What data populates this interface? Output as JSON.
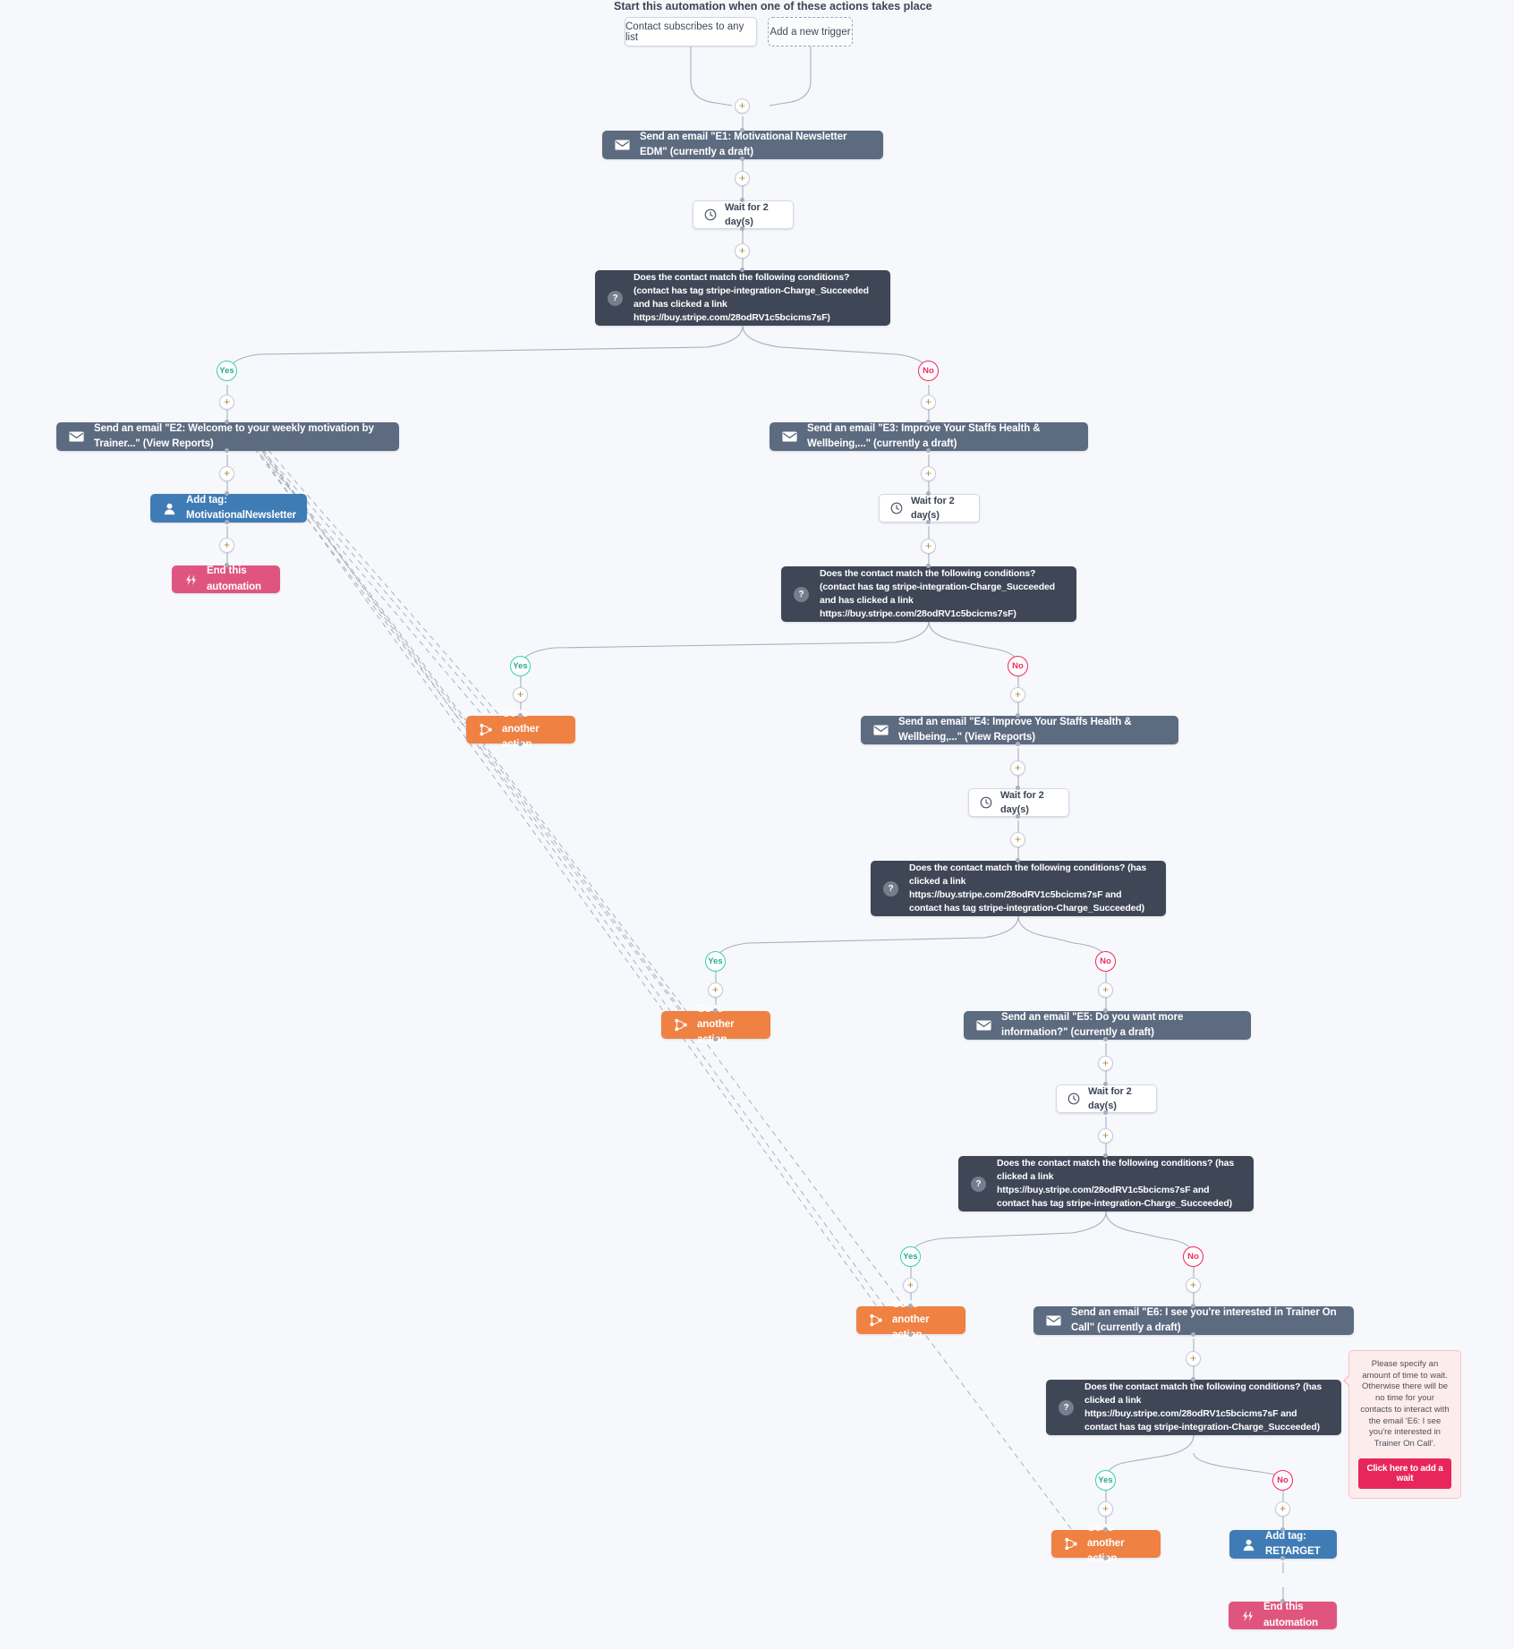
{
  "header": {
    "title": "Start this automation when one of these actions takes place"
  },
  "triggers": [
    {
      "label": "Contact subscribes to any list",
      "style": "solid"
    },
    {
      "label": "Add a new trigger",
      "style": "dashed"
    }
  ],
  "branch_labels": {
    "yes": "Yes",
    "no": "No"
  },
  "icons": {
    "envelope": "envelope-icon",
    "person": "person-icon",
    "clock": "clock-icon",
    "question": "question-mark-icon",
    "goto": "branch-goto-icon",
    "end": "end-automation-icon",
    "plus": "+"
  },
  "colors": {
    "action_dark": "#5d6b80",
    "condition_dark": "#3f4656",
    "tag_blue": "#3f7cb6",
    "end_pink": "#e0557f",
    "goto_orange": "#ef8143",
    "yes_green": "#2fd3b0",
    "no_red": "#f2255f",
    "canvas_bg": "#f7f8fc"
  },
  "nodes": {
    "e1": "Send an email \"E1: Motivational Newsletter EDM\" (currently a draft)",
    "wait1": "Wait for 2 day(s)",
    "cond1": "Does the contact match the following conditions? (contact has tag stripe-integration-Charge_Succeeded and has clicked a link https://buy.stripe.com/28odRV1c5bcicms7sF)",
    "e2": "Send an email \"E2: Welcome to your weekly motivation by Trainer...\" (View Reports)",
    "tag1": "Add tag: MotivationalNewsletter",
    "end1": "End this automation",
    "e3": "Send an email \"E3: Improve Your Staffs Health & Wellbeing,...\" (currently a draft)",
    "wait2": "Wait for 2 day(s)",
    "cond2": "Does the contact match the following conditions? (contact has tag stripe-integration-Charge_Succeeded and has clicked a link https://buy.stripe.com/28odRV1c5bcicms7sF)",
    "goto1": "Go to another action",
    "e4": "Send an email \"E4: Improve Your Staffs Health & Wellbeing,...\" (View Reports)",
    "wait3": "Wait for 2 day(s)",
    "cond3": "Does the contact match the following conditions? (has clicked a link https://buy.stripe.com/28odRV1c5bcicms7sF and contact has tag stripe-integration-Charge_Succeeded)",
    "goto2": "Go to another action",
    "e5": "Send an email \"E5: Do you want more information?\" (currently a draft)",
    "wait4": "Wait for 2 day(s)",
    "cond4": "Does the contact match the following conditions? (has clicked a link https://buy.stripe.com/28odRV1c5bcicms7sF and contact has tag stripe-integration-Charge_Succeeded)",
    "goto3": "Go to another action",
    "e6": "Send an email \"E6: I see you're interested in Trainer On Call\" (currently a draft)",
    "cond5": "Does the contact match the following conditions? (has clicked a link https://buy.stripe.com/28odRV1c5bcicms7sF and contact has tag stripe-integration-Charge_Succeeded)",
    "goto4": "Go to another action",
    "tag2": "Add tag: RETARGET",
    "end2": "End this automation"
  },
  "tooltip": {
    "message": "Please specify an amount of time to wait. Otherwise there will be no time for your contacts to interact with the email 'E6: I see you're interested in Trainer On Call'.",
    "button": "Click here to add a wait"
  }
}
